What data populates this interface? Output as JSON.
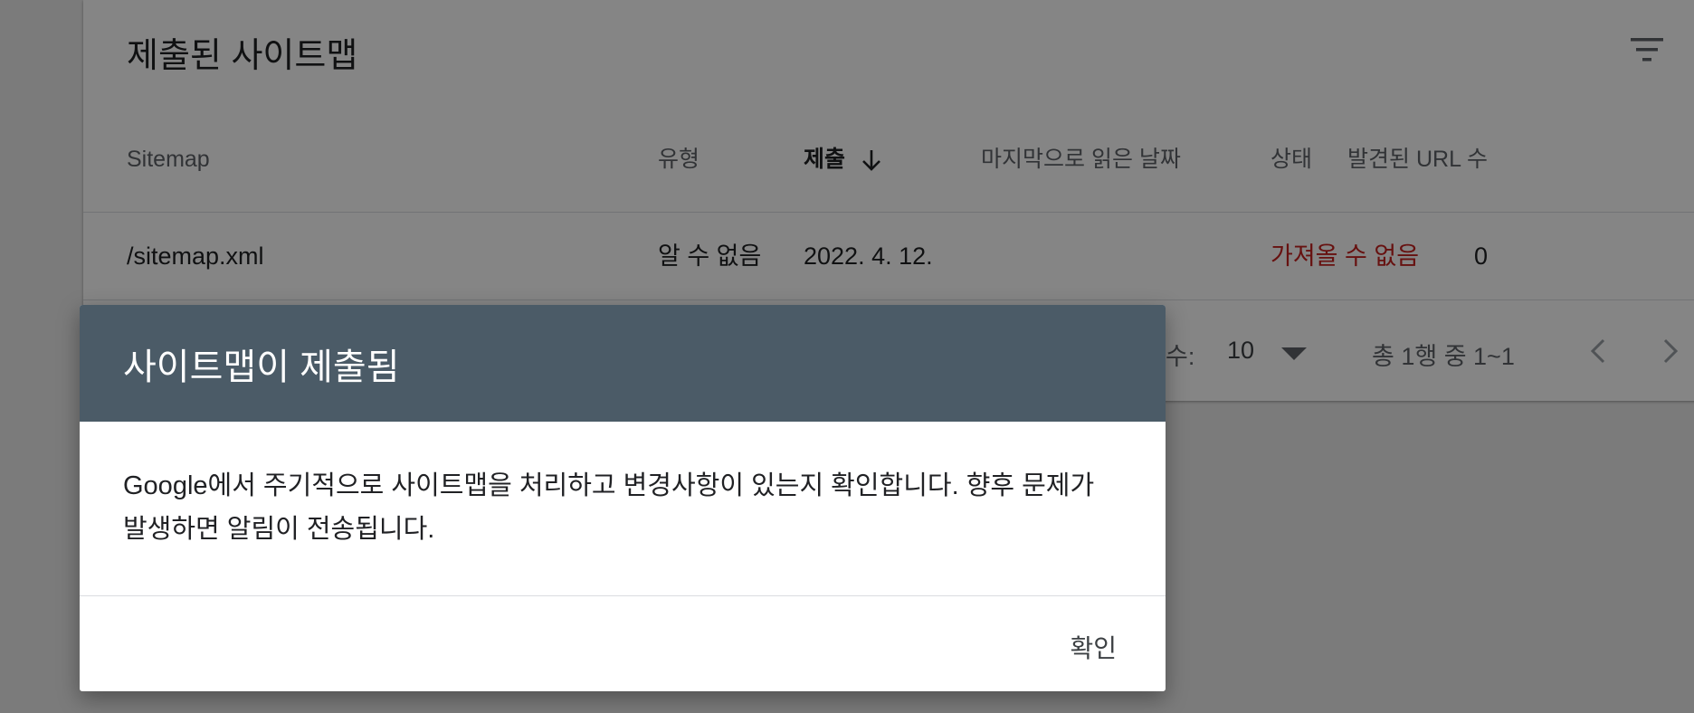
{
  "card": {
    "title": "제출된 사이트맵",
    "filter_icon": "filter-list-icon"
  },
  "table": {
    "columns": {
      "sitemap": "Sitemap",
      "type": "유형",
      "submitted": "제출",
      "last_read": "마지막으로 읽은 날짜",
      "status": "상태",
      "discovered_urls": "발견된 URL 수"
    },
    "sort_icon": "arrow-downward-icon",
    "rows": [
      {
        "sitemap": "/sitemap.xml",
        "type": "알 수 없음",
        "submitted": "2022. 4. 12.",
        "last_read": "",
        "status": "가져올 수 없음",
        "discovered_urls": "0"
      }
    ]
  },
  "pagination": {
    "rows_label_partial": "수:",
    "rows_per_page": "10",
    "range": "총 1행 중 1~1",
    "prev_icon": "chevron-left-icon",
    "next_icon": "chevron-right-icon"
  },
  "dialog": {
    "title": "사이트맵이 제출됨",
    "body": "Google에서 주기적으로 사이트맵을 처리하고 변경사항이 있는지 확인합니다. 향후 문제가 발생하면 알림이 전송됩니다.",
    "ok_label": "확인"
  },
  "colors": {
    "dialog_header": "#4b5b67",
    "status_error": "#c5221f"
  }
}
